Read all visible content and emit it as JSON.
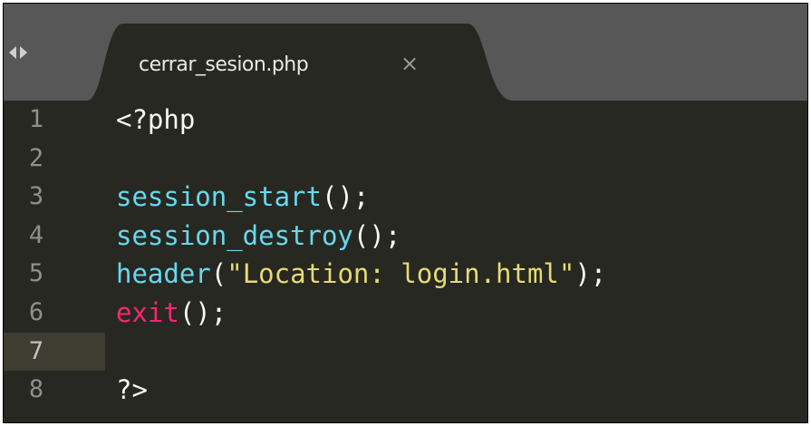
{
  "tab": {
    "filename": "cerrar_sesion.php",
    "close_glyph": "×"
  },
  "icons": {
    "nav_back": "chevron-left-icon",
    "nav_forward": "chevron-right-icon",
    "close": "close-icon"
  },
  "colors": {
    "background": "#272822",
    "tabbar": "#575757",
    "active_tab": "#272822",
    "function": "#66d9ef",
    "string": "#e6db74",
    "keyword": "#f92672",
    "text": "#f8f8f2",
    "line_number": "#90908a",
    "current_line": "#3e3d32"
  },
  "editor": {
    "current_line": 7,
    "lines": [
      {
        "n": "1",
        "tokens": [
          {
            "t": "<?php",
            "c": "plain"
          }
        ]
      },
      {
        "n": "2",
        "tokens": []
      },
      {
        "n": "3",
        "tokens": [
          {
            "t": "session_start",
            "c": "fn"
          },
          {
            "t": "();",
            "c": "plain"
          }
        ]
      },
      {
        "n": "4",
        "tokens": [
          {
            "t": "session_destroy",
            "c": "fn"
          },
          {
            "t": "();",
            "c": "plain"
          }
        ]
      },
      {
        "n": "5",
        "tokens": [
          {
            "t": "header",
            "c": "fn"
          },
          {
            "t": "(",
            "c": "plain"
          },
          {
            "t": "\"Location: login.html\"",
            "c": "str"
          },
          {
            "t": ");",
            "c": "plain"
          }
        ]
      },
      {
        "n": "6",
        "tokens": [
          {
            "t": "exit",
            "c": "kw"
          },
          {
            "t": "();",
            "c": "plain"
          }
        ]
      },
      {
        "n": "7",
        "tokens": []
      },
      {
        "n": "8",
        "tokens": [
          {
            "t": "?>",
            "c": "plain"
          }
        ]
      }
    ]
  }
}
